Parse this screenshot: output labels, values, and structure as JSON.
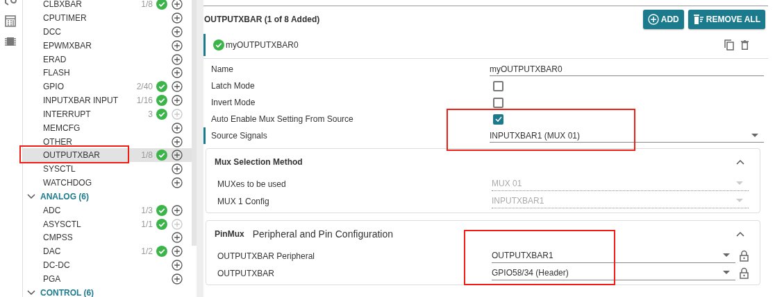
{
  "sidebar": {
    "groups": [
      {
        "children": [
          {
            "label": "CLBXBAR",
            "count": "1/8",
            "configured": true,
            "can_add": true,
            "selected": false
          },
          {
            "label": "CPUTIMER",
            "configured": false,
            "can_add": true,
            "selected": false
          },
          {
            "label": "DCC",
            "configured": false,
            "can_add": true,
            "selected": false
          },
          {
            "label": "EPWMXBAR",
            "configured": false,
            "can_add": true,
            "selected": false
          },
          {
            "label": "ERAD",
            "configured": false,
            "can_add": true,
            "selected": false
          },
          {
            "label": "FLASH",
            "configured": false,
            "can_add": true,
            "selected": false
          },
          {
            "label": "GPIO",
            "count": "2/40",
            "configured": true,
            "can_add": true,
            "selected": false
          },
          {
            "label": "INPUTXBAR INPUT",
            "count": "1/16",
            "configured": true,
            "can_add": true,
            "selected": false
          },
          {
            "label": "INTERRUPT",
            "count": "3",
            "configured": true,
            "can_add": false,
            "selected": false
          },
          {
            "label": "MEMCFG",
            "configured": false,
            "can_add": true,
            "selected": false
          },
          {
            "label": "OTHER",
            "configured": false,
            "can_add": true,
            "selected": false
          },
          {
            "label": "OUTPUTXBAR",
            "count": "1/8",
            "configured": true,
            "can_add": true,
            "selected": true
          },
          {
            "label": "SYSCTL",
            "configured": false,
            "can_add": true,
            "selected": false
          },
          {
            "label": "WATCHDOG",
            "configured": false,
            "can_add": true,
            "selected": false
          }
        ]
      },
      {
        "label": "ANALOG (6)",
        "expanded": true,
        "children": [
          {
            "label": "ADC",
            "count": "1/3",
            "configured": true,
            "can_add": true,
            "selected": false
          },
          {
            "label": "ASYSCTL",
            "count": "1/1",
            "configured": true,
            "can_add": false,
            "selected": false
          },
          {
            "label": "CMPSS",
            "configured": false,
            "can_add": true,
            "selected": false
          },
          {
            "label": "DAC",
            "count": "1/2",
            "configured": true,
            "can_add": true,
            "selected": false
          },
          {
            "label": "DC-DC",
            "configured": false,
            "can_add": true,
            "selected": false
          },
          {
            "label": "PGA",
            "configured": false,
            "can_add": true,
            "selected": false
          }
        ]
      },
      {
        "label": "CONTROL (6)",
        "expanded": true
      }
    ]
  },
  "main": {
    "title": "OUTPUTXBAR (1 of 8 Added)",
    "buttons": [
      {
        "label": "ADD",
        "kind": "add"
      },
      {
        "label": "REMOVE ALL",
        "kind": "remove_all"
      }
    ],
    "instance": {
      "name": "myOUTPUTXBAR0",
      "valid": true
    },
    "properties": [
      {
        "label": "Name",
        "kind": "text",
        "value": "myOUTPUTXBAR0",
        "focused": false
      },
      {
        "label": "Latch Mode",
        "kind": "checkbox",
        "checked": false,
        "focused": false
      },
      {
        "label": "Invert Mode",
        "kind": "checkbox",
        "checked": false,
        "focused": false
      },
      {
        "label": "Auto Enable Mux Setting From Source",
        "kind": "checkbox",
        "checked": true,
        "focused": false
      },
      {
        "label": "Source Signals",
        "kind": "select",
        "value": "INPUTXBAR1 (MUX 01)",
        "focused": true
      }
    ],
    "sections": [
      {
        "heading": "Mux Selection Method",
        "expanded": true,
        "rows": [
          {
            "label": "MUXes to be used",
            "value": "MUX 01",
            "disabled": true,
            "locked": false
          },
          {
            "label": "MUX 1 Config",
            "value": "INPUTXBAR1",
            "disabled": true,
            "locked": false
          }
        ]
      },
      {
        "heading": "PinMux",
        "subtitle": "Peripheral and Pin Configuration",
        "expanded": true,
        "rows": [
          {
            "label": "OUTPUTXBAR Peripheral",
            "value": "OUTPUTXBAR1",
            "disabled": false,
            "locked": true
          },
          {
            "label": "OUTPUTXBAR",
            "value": "GPIO58/34 (Header)",
            "disabled": false,
            "locked": true
          }
        ]
      }
    ]
  }
}
